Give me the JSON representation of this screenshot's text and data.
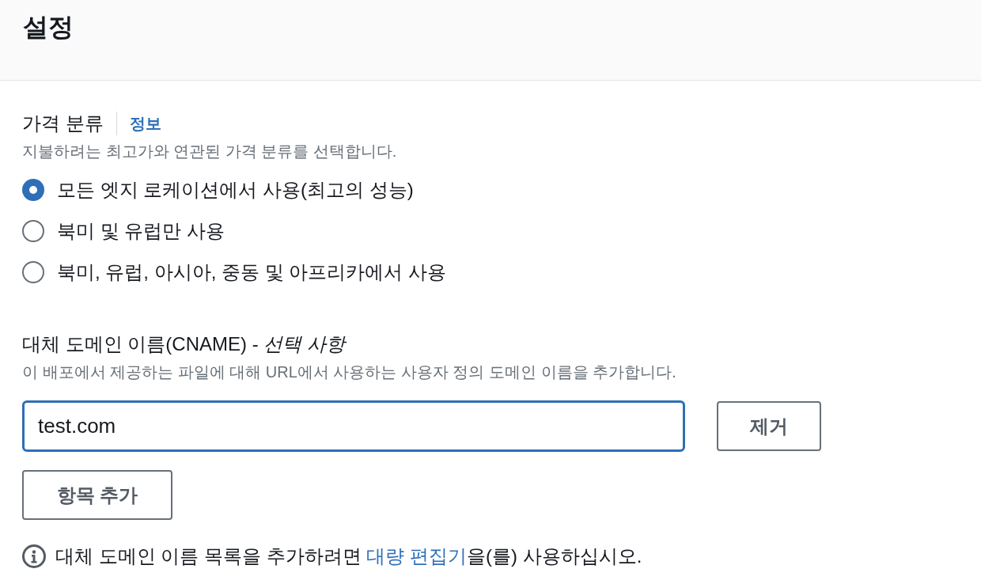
{
  "header": {
    "title": "설정"
  },
  "price_class": {
    "label": "가격 분류",
    "info_link": "정보",
    "description": "지불하려는 최고가와 연관된 가격 분류를 선택합니다.",
    "options": [
      {
        "label": "모든 엣지 로케이션에서 사용(최고의 성능)",
        "selected": true
      },
      {
        "label": "북미 및 유럽만 사용",
        "selected": false
      },
      {
        "label": "북미, 유럽, 아시아, 중동 및 아프리카에서 사용",
        "selected": false
      }
    ]
  },
  "alternate_domains": {
    "label": "대체 도메인 이름(CNAME) - *선택 사항*",
    "description": "이 배포에서 제공하는 파일에 대해 URL에서 사용하는 사용자 정의 도메인 이름을 추가합니다.",
    "entries": [
      {
        "value": "test.com",
        "focused": true,
        "remove_button": "제거"
      }
    ],
    "add_button": "항목 추가"
  },
  "notice": {
    "text_before": "대체 도메인 이름 목록을 추가하려면 ",
    "link": "대량 편집기",
    "text_after": "을(를) 사용하십시오."
  }
}
